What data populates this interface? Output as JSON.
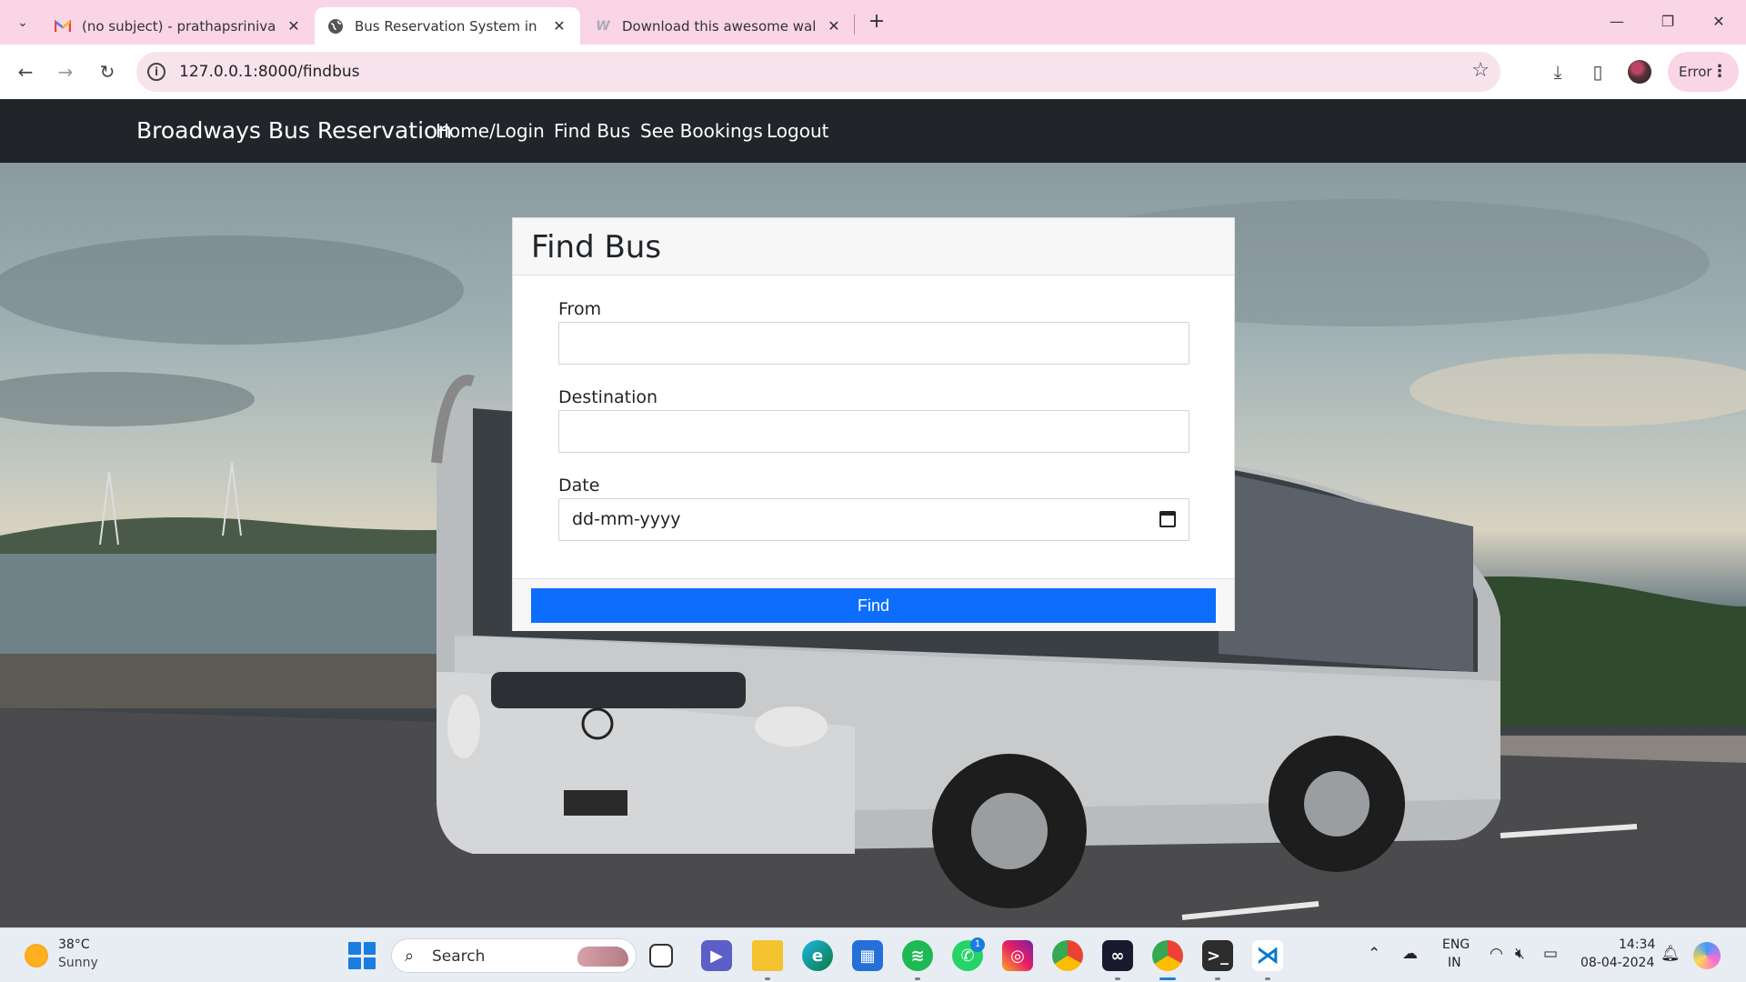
{
  "browser": {
    "tabs": [
      {
        "title": "(no subject) - prathapsrinivasan",
        "icon": "gmail-icon",
        "active": false
      },
      {
        "title": "Bus Reservation System in Djan",
        "icon": "globe-icon",
        "active": true
      },
      {
        "title": "Download this awesome wallpa",
        "icon": "wallhaven-icon",
        "active": false
      }
    ],
    "url": "127.0.0.1:8000/findbus",
    "profile_label": "Error"
  },
  "navbar": {
    "brand": "Broadways Bus Reservation",
    "links": [
      "Home/Login",
      "Find Bus",
      "See Bookings",
      "Logout"
    ]
  },
  "form": {
    "title": "Find Bus",
    "from_label": "From",
    "from_value": "",
    "destination_label": "Destination",
    "destination_value": "",
    "date_label": "Date",
    "date_placeholder": "dd-mm-yyyy",
    "submit_label": "Find"
  },
  "colors": {
    "navbar_bg": "#212529",
    "primary_button": "#0d6efd",
    "tabstrip_bg": "#f9d5e5"
  },
  "taskbar": {
    "weather_temp": "38°C",
    "weather_desc": "Sunny",
    "search_label": "Search",
    "whatsapp_badge": "1",
    "lang_line1": "ENG",
    "lang_line2": "IN",
    "time": "14:34",
    "date": "08-04-2024"
  }
}
